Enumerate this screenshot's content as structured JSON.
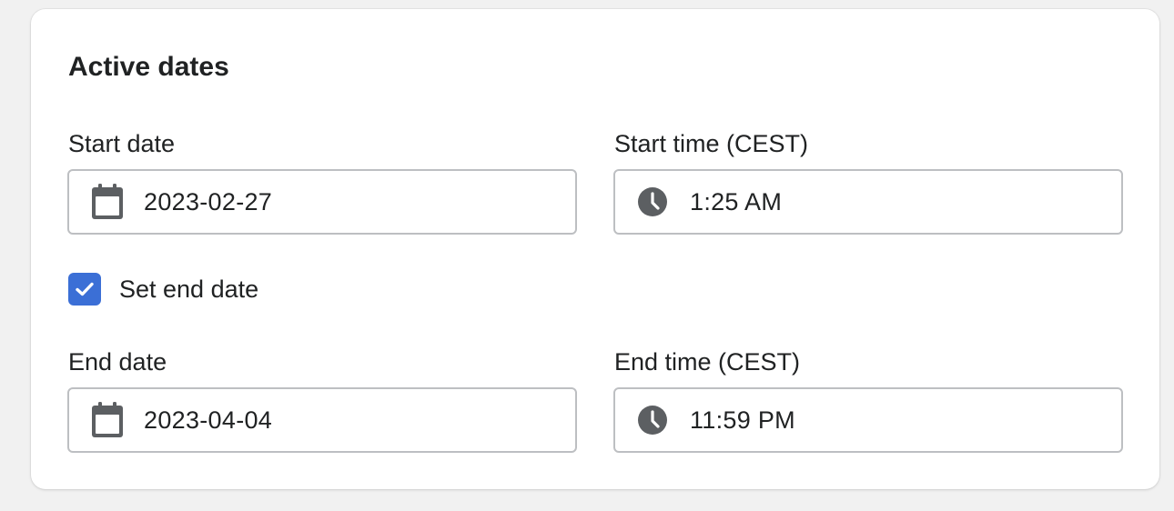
{
  "card": {
    "title": "Active dates"
  },
  "start_date": {
    "label": "Start date",
    "value": "2023-02-27",
    "icon": "calendar-icon"
  },
  "start_time": {
    "label": "Start time (CEST)",
    "value": "1:25 AM",
    "icon": "clock-icon"
  },
  "set_end_date": {
    "label": "Set end date",
    "checked": true,
    "color": "#3b6fd6"
  },
  "end_date": {
    "label": "End date",
    "value": "2023-04-04",
    "icon": "calendar-icon"
  },
  "end_time": {
    "label": "End time (CEST)",
    "value": "11:59 PM",
    "icon": "clock-icon"
  },
  "colors": {
    "icon": "#5c5f62",
    "border": "#bdbfc2",
    "text": "#202223"
  }
}
